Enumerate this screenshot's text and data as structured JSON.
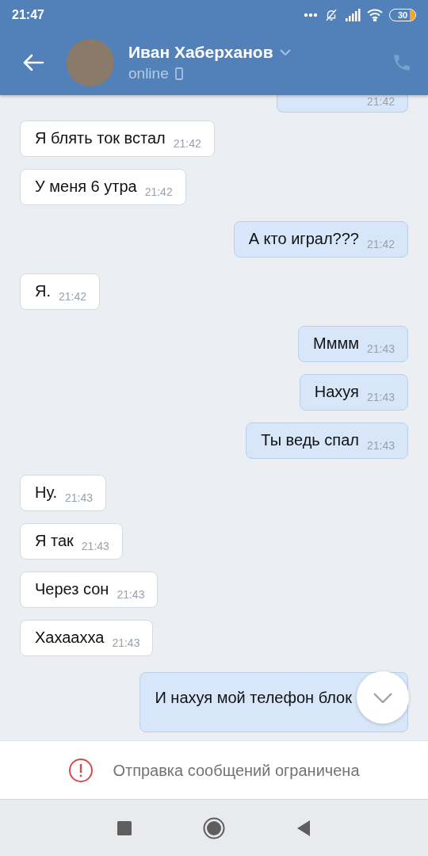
{
  "status_bar": {
    "time": "21:47",
    "battery": "30"
  },
  "header": {
    "name": "Иван Хаберханов",
    "status": "online"
  },
  "partial_message": {
    "kind": "outgoing",
    "time": "21:42"
  },
  "messages": [
    {
      "kind": "incoming",
      "text": "Я блять ток встал",
      "time": "21:42"
    },
    {
      "kind": "incoming",
      "text": "У меня 6 утра",
      "time": "21:42"
    },
    {
      "kind": "outgoing",
      "text": "А кто играл???",
      "time": "21:42"
    },
    {
      "kind": "incoming",
      "text": "Я.",
      "time": "21:42"
    },
    {
      "kind": "outgoing",
      "text": "Мммм",
      "time": "21:43"
    },
    {
      "kind": "outgoing",
      "text": "Нахуя",
      "time": "21:43"
    },
    {
      "kind": "outgoing",
      "text": "Ты ведь спал",
      "time": "21:43"
    },
    {
      "kind": "incoming",
      "text": "Ну.",
      "time": "21:43"
    },
    {
      "kind": "incoming",
      "text": "Я так",
      "time": "21:43"
    },
    {
      "kind": "incoming",
      "text": "Через сон",
      "time": "21:43"
    },
    {
      "kind": "incoming",
      "text": "Хахаахха",
      "time": "21:43"
    },
    {
      "kind": "outgoing",
      "text": "И нахуя мой телефон блок"
    }
  ],
  "notice": "Отправка сообщений ограничена"
}
